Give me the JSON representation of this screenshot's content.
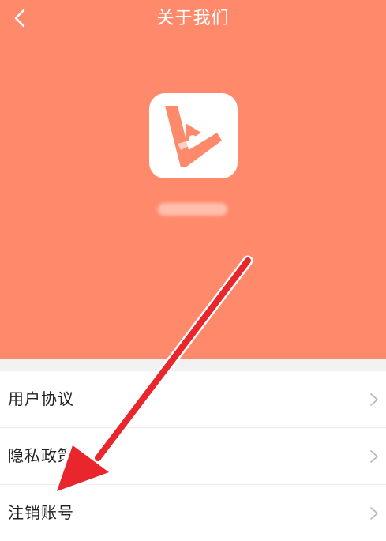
{
  "header": {
    "title": "关于我们",
    "back_icon": "chevron-left-icon"
  },
  "app": {
    "icon": "app-logo-icon",
    "name_blurred": ""
  },
  "menu": {
    "items": [
      {
        "label": "用户协议",
        "icon": "chevron-right-icon"
      },
      {
        "label": "隐私政策",
        "icon": "chevron-right-icon"
      },
      {
        "label": "注销账号",
        "icon": "chevron-right-icon"
      }
    ]
  },
  "annotation": {
    "icon": "red-arrow-pointer",
    "color": "#e8262b"
  },
  "colors": {
    "hero_background": "#ff8a6b",
    "page_background": "#f2f2f2"
  }
}
